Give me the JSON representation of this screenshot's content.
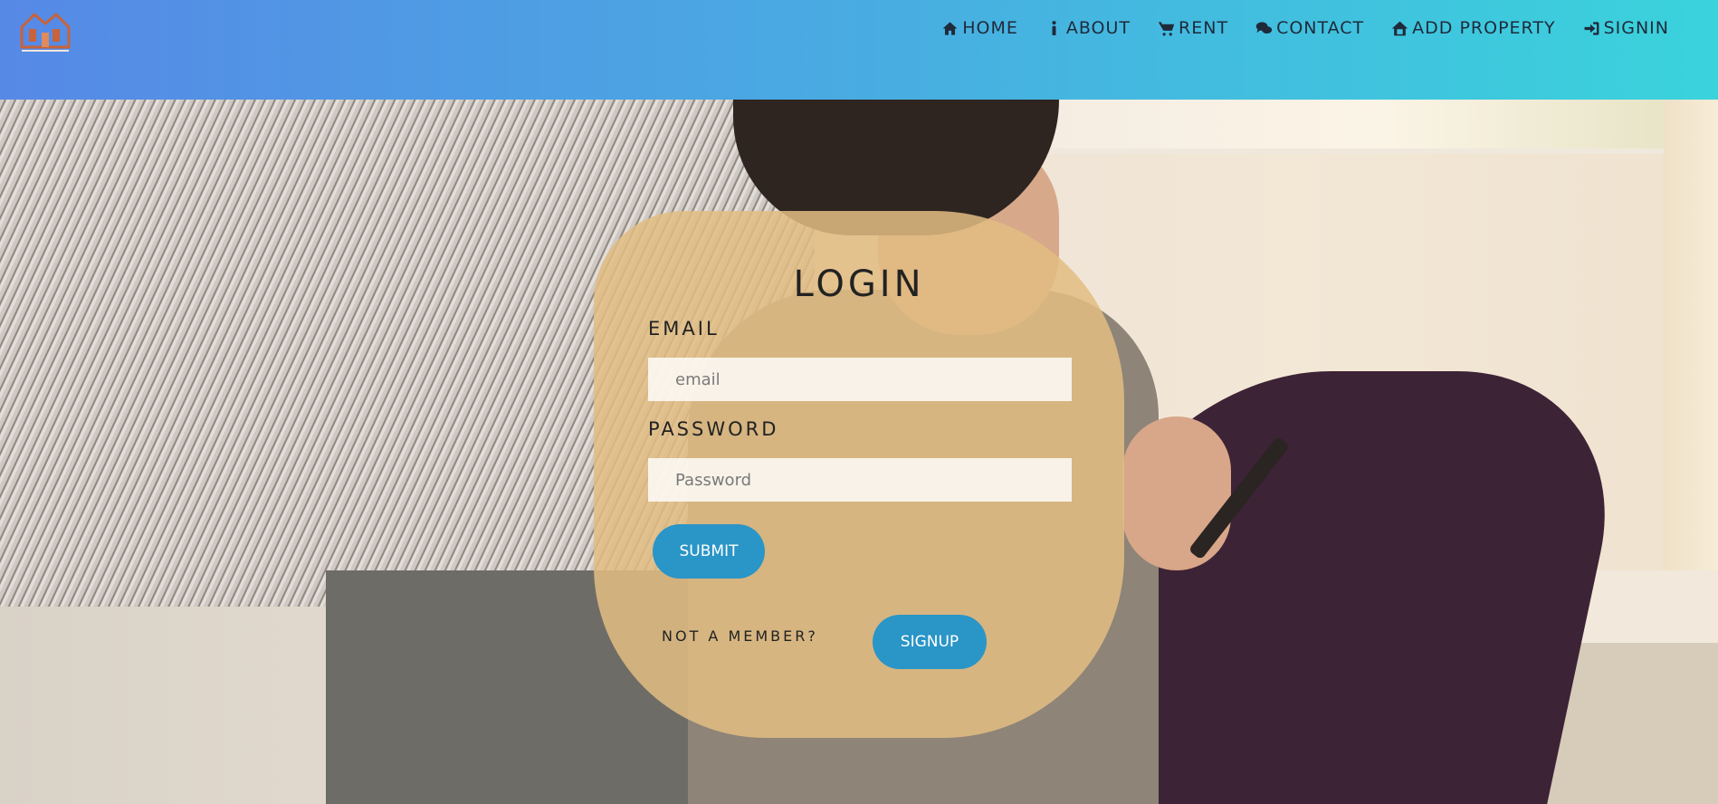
{
  "nav": {
    "logo_alt": "logo",
    "items": [
      {
        "icon": "home-icon",
        "label": "HOME"
      },
      {
        "icon": "info-icon",
        "label": "ABOUT"
      },
      {
        "icon": "cart-icon",
        "label": "RENT"
      },
      {
        "icon": "chat-icon",
        "label": "CONTACT"
      },
      {
        "icon": "house-plus-icon",
        "label": "ADD PROPERTY"
      },
      {
        "icon": "signin-icon",
        "label": "SIGNIN"
      }
    ]
  },
  "login": {
    "title": "LOGIN",
    "email_label": "EMAIL",
    "email_placeholder": "email",
    "password_label": "PASSWORD",
    "password_placeholder": "Password",
    "submit_label": "SUBMIT",
    "member_text": "NOT A MEMBER?",
    "signup_label": "SIGNUP"
  },
  "colors": {
    "button": "#2a95c7",
    "card": "#e2bd82",
    "header_start": "#5689e6",
    "header_end": "#3ad3dc"
  }
}
